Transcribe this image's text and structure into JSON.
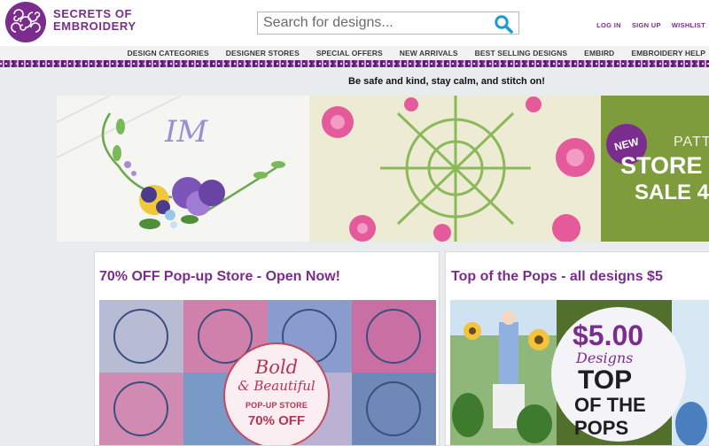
{
  "brand": {
    "name_line1": "SECRETS OF",
    "name_line2": "EMBROIDERY",
    "color": "#7b2d8e"
  },
  "search": {
    "placeholder": "Search for designs...",
    "icon": "search-icon"
  },
  "account_links": [
    "LOG IN",
    "SIGN UP",
    "WISHLIST"
  ],
  "nav": [
    "DESIGN CATEGORIES",
    "DESIGNER STORES",
    "SPECIAL OFFERS",
    "NEW ARRIVALS",
    "BEST SELLING DESIGNS",
    "EMBIRD",
    "EMBROIDERY HELP"
  ],
  "announcement": "Be safe and kind, stay calm, and stitch on!",
  "banner": {
    "badge": "NEW",
    "line1": "PATT",
    "line2": "STORE O",
    "line3": "SALE 4"
  },
  "cards": [
    {
      "title": "70% OFF Pop-up Store - Open Now!",
      "stamp": {
        "line1": "Bold",
        "line2": "& Beautiful",
        "line3": "POP-UP STORE",
        "line4": "70% OFF"
      }
    },
    {
      "title": "Top of the Pops - all designs $5",
      "stamp": {
        "line1": "$5.00",
        "line2": "Designs",
        "line3": "TOP",
        "line4": "OF THE POPS"
      }
    }
  ],
  "colors": {
    "accent": "#7b2d8e",
    "background": "#e8ecef",
    "nav_bg": "#f2f2f2"
  }
}
